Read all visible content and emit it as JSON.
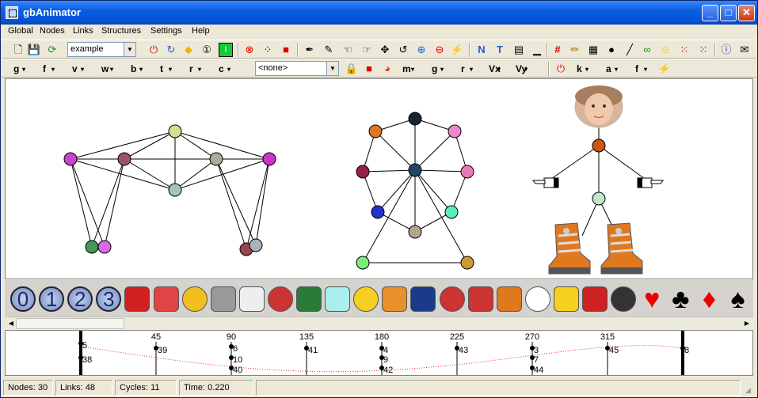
{
  "window": {
    "title": "gbAnimator",
    "controls": {
      "minimize": "_",
      "maximize": "□",
      "close": "✕"
    }
  },
  "menu": [
    "Global",
    "Nodes",
    "Links",
    "Structures",
    "Settings",
    "Help"
  ],
  "toolbar1": {
    "structure_select": "example",
    "icons": [
      "new-icon",
      "open-icon",
      "save-icon",
      "refresh-icon",
      "power-icon",
      "rotate-icon",
      "diamond-icon",
      "one-icon",
      "chart-icon",
      "stop-icon",
      "dots-icon",
      "flag-icon",
      "pen-icon",
      "pen2-icon",
      "hand-icon",
      "hand2-icon",
      "move-icon",
      "undo-icon",
      "plus-icon",
      "minus-icon",
      "flash-icon",
      "n-box-icon",
      "t-box-icon",
      "list-icon",
      "line-icon",
      "hash-icon",
      "pencil-icon",
      "layer-icon",
      "dot-icon",
      "slash-icon",
      "link-icon",
      "smiley-icon",
      "grid-icon",
      "grid2-icon",
      "info-icon",
      "mail-icon"
    ]
  },
  "toolbar2": {
    "labels_left": [
      "g",
      "f",
      "v",
      "w",
      "b",
      "t",
      "r",
      "c"
    ],
    "node_select": "<none>",
    "labels_right": [
      "m",
      "g",
      "r"
    ],
    "vx_labels": [
      "Vx",
      "Vy"
    ],
    "labels_far": [
      "k",
      "a",
      "f"
    ]
  },
  "palette": [
    {
      "name": "zero-icon",
      "glyph": "0"
    },
    {
      "name": "one-icon",
      "glyph": "1"
    },
    {
      "name": "two-icon",
      "glyph": "2"
    },
    {
      "name": "three-icon",
      "glyph": "3"
    },
    {
      "name": "apple-icon",
      "glyph": ""
    },
    {
      "name": "balloon-icon",
      "glyph": ""
    },
    {
      "name": "batman-icon",
      "glyph": ""
    },
    {
      "name": "clock-icon",
      "glyph": ""
    },
    {
      "name": "cloud-icon",
      "glyph": ""
    },
    {
      "name": "us-map-icon",
      "glyph": ""
    },
    {
      "name": "globe-icon",
      "glyph": ""
    },
    {
      "name": "eyes-icon",
      "glyph": ""
    },
    {
      "name": "sad-face-icon",
      "glyph": ""
    },
    {
      "name": "match-icon",
      "glyph": ""
    },
    {
      "name": "uk-flag-icon",
      "glyph": ""
    },
    {
      "name": "waving-flag-icon",
      "glyph": ""
    },
    {
      "name": "us-flag-icon",
      "glyph": ""
    },
    {
      "name": "boot-icon",
      "glyph": ""
    },
    {
      "name": "pointing-hand-icon",
      "glyph": ""
    },
    {
      "name": "lightning-icon",
      "glyph": ""
    },
    {
      "name": "magnet-icon",
      "glyph": ""
    },
    {
      "name": "music-icon",
      "glyph": ""
    },
    {
      "name": "heart-icon",
      "glyph": "♥"
    },
    {
      "name": "club-icon",
      "glyph": "♣"
    },
    {
      "name": "diamond-suit-icon",
      "glyph": "♦"
    },
    {
      "name": "spade-icon",
      "glyph": "♠"
    },
    {
      "name": "black-circle-icon",
      "glyph": ""
    }
  ],
  "timeline": {
    "ticks": [
      "45",
      "90",
      "135",
      "180",
      "225",
      "270",
      "315"
    ],
    "markers": [
      "5",
      "38",
      "39",
      "6",
      "10",
      "40",
      "41",
      "4",
      "9",
      "42",
      "43",
      "3",
      "7",
      "44",
      "45",
      "8"
    ]
  },
  "status": {
    "nodes": "Nodes: 30",
    "links": "Links: 48",
    "cycles": "Cycles: 11",
    "time": "Time:  0.220"
  },
  "colors": {
    "titlebar": "#0a5ee4",
    "canvas_bg": "#ffffff",
    "chrome": "#ece9d8"
  }
}
